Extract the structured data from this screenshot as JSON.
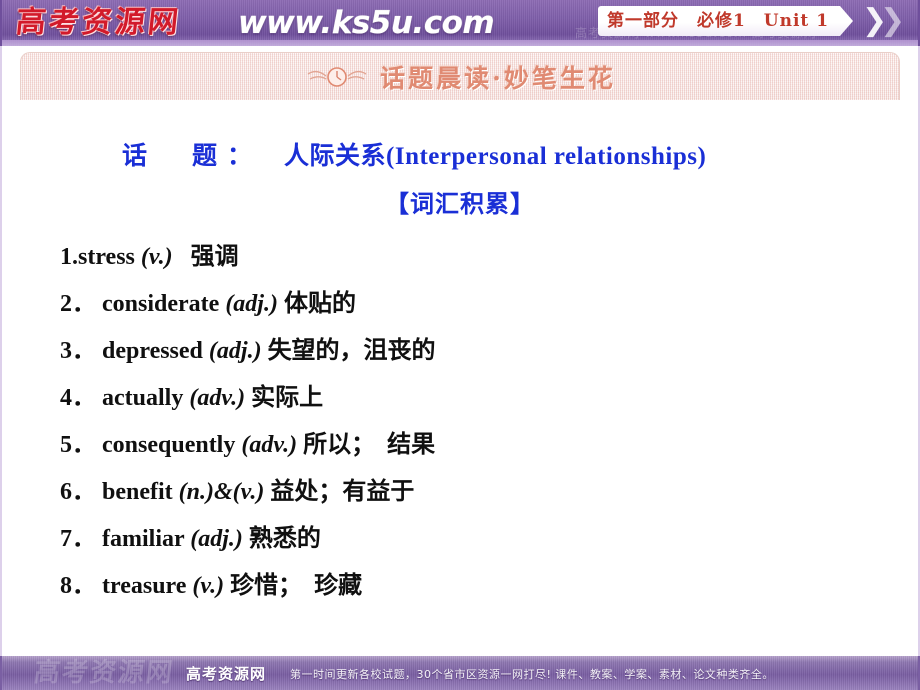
{
  "header": {
    "logo_text": "高考资源网",
    "site_url": "www.ks5u.com",
    "ghost_text": "高考资源网 www.ks5u.com 高考资源网",
    "chapter_tag": "第一部分　必修1　Unit 1",
    "chevron_glyph": "❯"
  },
  "banner": {
    "icon_name": "winged-clock-icon",
    "title": "话题晨读·妙笔生花"
  },
  "content": {
    "topic_label": "话　题：",
    "topic_value": "人际关系(Interpersonal relationships)",
    "section_title": "【词汇积累】",
    "vocab": [
      {
        "num": "1.",
        "word": "stress",
        "pos": "(v.)",
        "cn": "强调"
      },
      {
        "num": "2．",
        "word": "considerate",
        "pos": "(adj.)",
        "cn": "体贴的"
      },
      {
        "num": "3．",
        "word": "depressed",
        "pos": "(adj.)",
        "cn": "失望的，沮丧的"
      },
      {
        "num": "4．",
        "word": "actually",
        "pos": "(adv.)",
        "cn": "实际上"
      },
      {
        "num": "5．",
        "word": "consequently",
        "pos": "(adv.)",
        "cn": "所以；　结果"
      },
      {
        "num": "6．",
        "word": "benefit",
        "pos": "(n.)&(v.)",
        "cn": "益处；有益于"
      },
      {
        "num": "7．",
        "word": "familiar",
        "pos": "(adj.)",
        "cn": "熟悉的"
      },
      {
        "num": "8．",
        "word": "treasure",
        "pos": "(v.)",
        "cn": "珍惜；　珍藏"
      }
    ]
  },
  "footer": {
    "watermark": "高考资源网",
    "logo_text": "高考资源网",
    "tagline": "第一时间更新各校试题，30个省市区资源一网打尽! 课件、教案、学案、素材、论文种类齐全。"
  },
  "colors": {
    "header_purple": "#7f5faa",
    "logo_red": "#d21a2a",
    "tag_red": "#c0392b",
    "banner_pink": "#f3dcd8",
    "banner_text": "#e08a72",
    "heading_blue": "#1a2fd6",
    "body_text": "#101010"
  }
}
